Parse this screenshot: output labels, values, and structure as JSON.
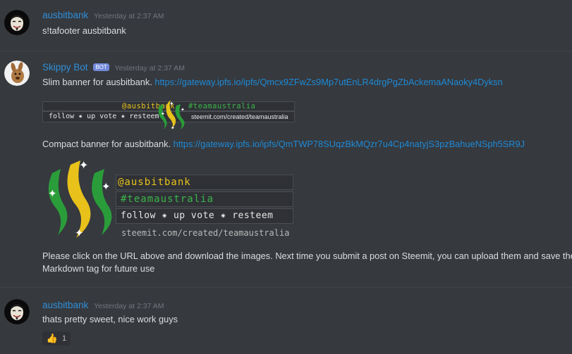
{
  "messages": [
    {
      "username": "ausbitbank",
      "timestamp": "Yesterday at 2:37 AM",
      "text": "s!tafooter ausbitbank"
    },
    {
      "username": "Skippy Bot",
      "bot_tag": "BOT",
      "timestamp": "Yesterday at 2:37 AM",
      "slim_text": "Slim banner for ausbitbank.",
      "slim_link": "https://gateway.ipfs.io/ipfs/Qmcx9ZFwZs9Mp7utEnLR4drgPgZbAckemaANaoky4Dyksn",
      "compact_text": "Compact banner for ausbitbank.",
      "compact_link": "https://gateway.ipfs.io/ipfs/QmTWP78SUqzBkMQzr7u4Cp4natyjS3pzBahueNSph5SR9J",
      "instructions_line1": "Please click on the URL above and download the images. Next time you submit a post on Steemit, you can upload them and save the",
      "instructions_line2": "Markdown tag for future use",
      "slim_banner": {
        "handle": "@ausbitbank",
        "tag": "#teamaustralia",
        "cta": "follow ✷ up vote ✷ resteem",
        "url": "steemit.com/created/teamaustralia"
      },
      "compact_banner": {
        "handle": "@ausbitbank",
        "tag": "#teamaustralia",
        "cta": "follow ✷ up vote ✷ resteem",
        "url": "steemit.com/created/teamaustralia"
      }
    },
    {
      "username": "ausbitbank",
      "timestamp": "Yesterday at 2:37 AM",
      "text": "thats pretty sweet, nice work guys",
      "reaction": {
        "emoji": "thumbs-up",
        "count": "1"
      }
    }
  ],
  "colors": {
    "background": "#36393e",
    "username": "#2f8fd8",
    "link": "#1e8ad6",
    "banner_yellow": "#e8c21a",
    "banner_green": "#2a9d3a"
  }
}
